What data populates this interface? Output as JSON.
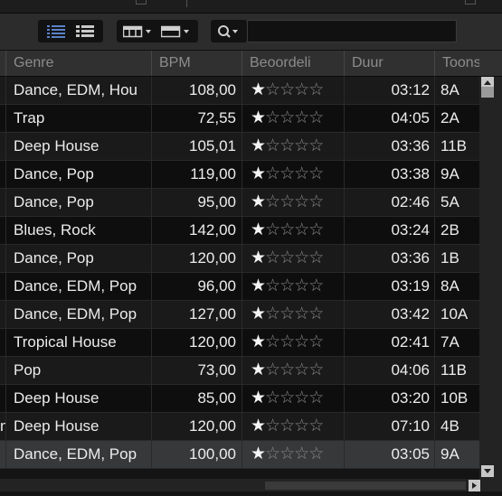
{
  "toolbar": {
    "search_value": ""
  },
  "columns": {
    "genre": "Genre",
    "bpm": "BPM",
    "rating": "Beoordeli",
    "duration": "Duur",
    "key": "Toonso"
  },
  "rows": [
    {
      "genre": "Dance, EDM, Hou",
      "bpm": "108,00",
      "rating": 1,
      "duration": "03:12",
      "key": "8A"
    },
    {
      "genre": "Trap",
      "bpm": "72,55",
      "rating": 1,
      "duration": "04:05",
      "key": "2A"
    },
    {
      "genre": "Deep House",
      "bpm": "105,01",
      "rating": 1,
      "duration": "03:36",
      "key": "11B"
    },
    {
      "genre": "Dance, Pop",
      "bpm": "119,00",
      "rating": 1,
      "duration": "03:38",
      "key": "9A"
    },
    {
      "genre": "Dance, Pop",
      "bpm": "95,00",
      "rating": 1,
      "duration": "02:46",
      "key": "5A"
    },
    {
      "genre": "Blues, Rock",
      "bpm": "142,00",
      "rating": 1,
      "duration": "03:24",
      "key": "2B"
    },
    {
      "genre": "Dance, Pop",
      "bpm": "120,00",
      "rating": 1,
      "duration": "03:36",
      "key": "1B"
    },
    {
      "genre": "Dance, EDM, Pop",
      "bpm": "96,00",
      "rating": 1,
      "duration": "03:19",
      "key": "8A"
    },
    {
      "genre": "Dance, EDM, Pop",
      "bpm": "127,00",
      "rating": 1,
      "duration": "03:42",
      "key": "10A"
    },
    {
      "genre": "Tropical House",
      "bpm": "120,00",
      "rating": 1,
      "duration": "02:41",
      "key": "7A"
    },
    {
      "genre": "Pop",
      "bpm": "73,00",
      "rating": 1,
      "duration": "04:06",
      "key": "11B"
    },
    {
      "genre": "Deep House",
      "bpm": "85,00",
      "rating": 1,
      "duration": "03:20",
      "key": "10B"
    },
    {
      "genre": "Deep House",
      "bpm": "120,00",
      "rating": 1,
      "duration": "07:10",
      "key": "4B",
      "left_fragment": "n"
    },
    {
      "genre": "Dance, EDM, Pop",
      "bpm": "100,00",
      "rating": 1,
      "duration": "03:05",
      "key": "9A",
      "selected": true
    }
  ],
  "rating_max": 5,
  "colors": {
    "background": "#141414",
    "header": "#303030",
    "toolbar": "#2c2c2c",
    "selected_row": "#36383a",
    "active_view_icon": "#5a82c8"
  }
}
